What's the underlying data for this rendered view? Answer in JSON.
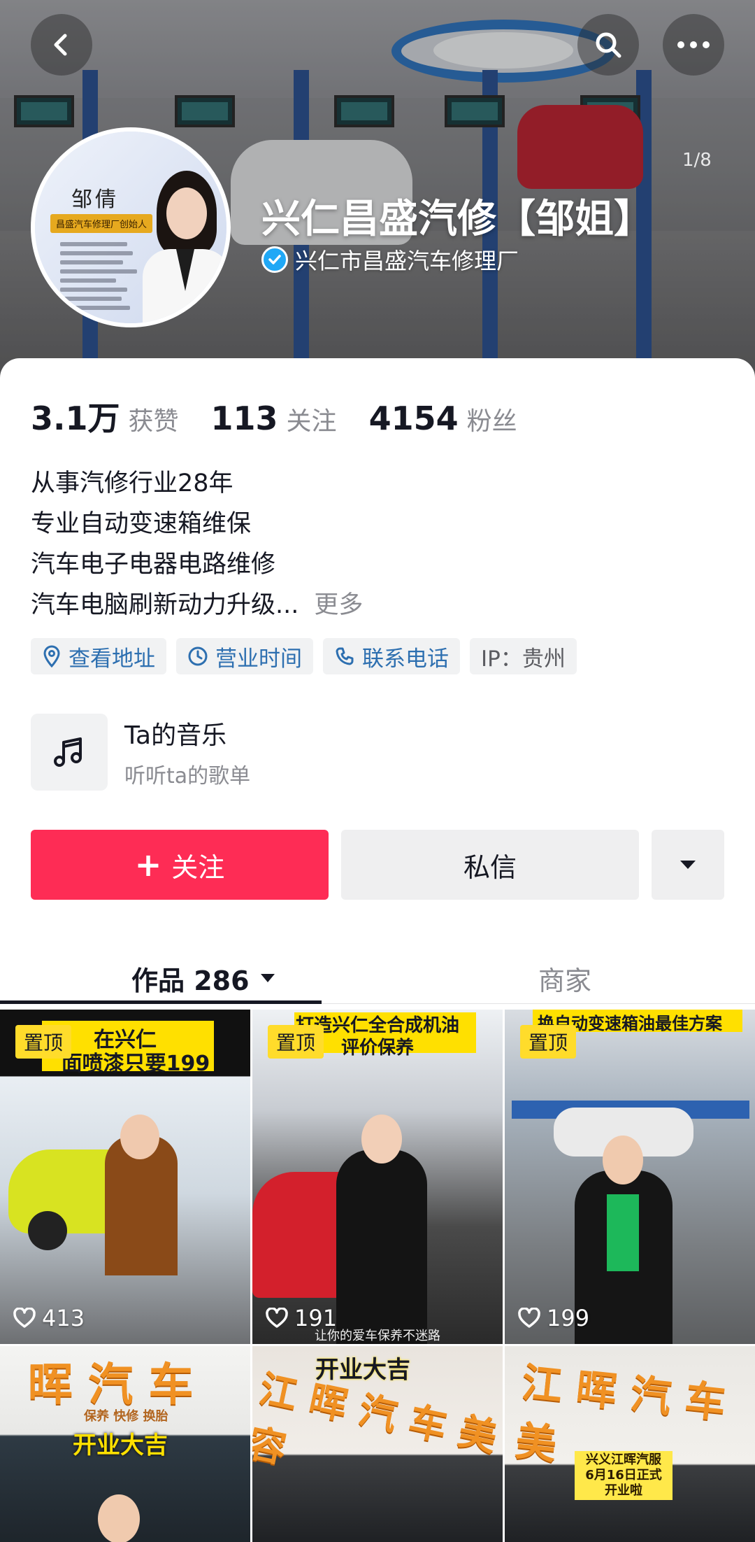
{
  "header": {
    "image_counter": "1/8",
    "title": "兴仁昌盛汽修【邹姐】",
    "verified_name": "兴仁市昌盛汽车修理厂"
  },
  "avatar": {
    "name": "邹倩",
    "tag": "昌盛汽车修理厂创始人"
  },
  "stats": [
    {
      "num": "3.1万",
      "label": "获赞"
    },
    {
      "num": "113",
      "label": "关注"
    },
    {
      "num": "4154",
      "label": "粉丝"
    }
  ],
  "bio": {
    "lines": [
      "从事汽修行业28年",
      "专业自动变速箱维保",
      "汽车电子电器电路维修",
      "汽车电脑刷新动力升级..."
    ],
    "more": "更多"
  },
  "chips": {
    "address": "查看地址",
    "hours": "营业时间",
    "phone": "联系电话",
    "ip": "IP：贵州"
  },
  "music": {
    "title": "Ta的音乐",
    "subtitle": "听听ta的歌单"
  },
  "actions": {
    "follow": "关注",
    "message": "私信"
  },
  "tabs": {
    "works": "作品 286",
    "shop": "商家"
  },
  "grid": {
    "pinned_label": "置顶",
    "cells": [
      {
        "caption1": "在兴仁",
        "caption2": "面喷漆只要199",
        "likes": "413"
      },
      {
        "caption1": "打造兴仁全合成机油",
        "caption2": "评价保养",
        "likes": "191",
        "footer": "让你的爱车保养不迷路"
      },
      {
        "caption1": "换自动变速箱油最佳方案",
        "likes": "199"
      },
      {
        "sign": "晖 汽 车",
        "subsign": "保养 快修 换胎",
        "banner": "开业大吉"
      },
      {
        "sign": "江 晖 汽 车 美 容",
        "banner": "开业大吉"
      },
      {
        "sign": "江 晖 汽 车 美",
        "banner": "兴义江晖汽服 6月16日正式开业啦"
      }
    ]
  },
  "colors": {
    "accent": "#fe2c55",
    "link": "#2d6fb0",
    "verified": "#20a8f6",
    "pin": "#ffdc2b"
  }
}
